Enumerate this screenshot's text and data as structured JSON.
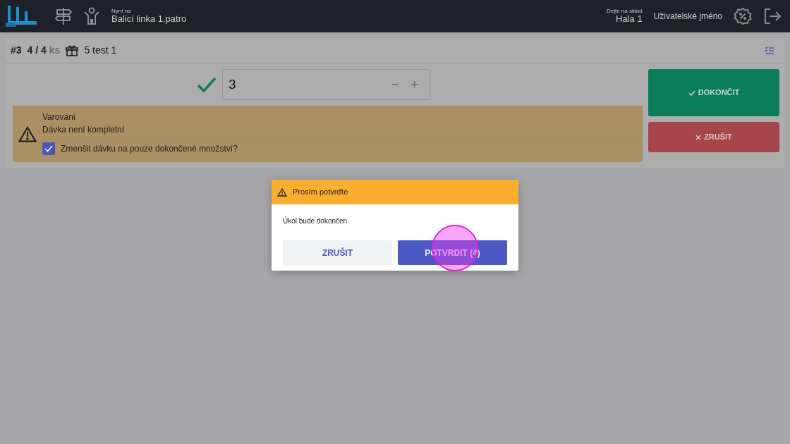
{
  "header": {
    "location_label": "Nyní na",
    "location": "Balicí linka 1.patro",
    "warehouse_label": "Dejte na sklad",
    "warehouse": "Hala 1",
    "username": "Uživatelské jméno"
  },
  "task": {
    "number": "#3",
    "quantity": "4 / 4",
    "unit": "ks",
    "product": "5 test 1"
  },
  "quantity_input": {
    "value": "3",
    "minus": "−",
    "plus": "+"
  },
  "alert": {
    "title": "Varování",
    "message": "Dávka není kompletní",
    "checkbox": {
      "label": "Zmenšit dávku na pouze dokončené množství?",
      "checked": true
    }
  },
  "actions": [
    {
      "label": "DOKONČIT",
      "kind": "finish"
    },
    {
      "label": "ZRUŠIT",
      "kind": "cancel"
    }
  ],
  "dialog": {
    "title": "Prosím potvrďte",
    "message": "Úkol bude dokončen",
    "buttons": [
      {
        "label": "ZRUŠIT",
        "kind": "secondary"
      },
      {
        "label": "POTVRDIT (4)",
        "kind": "primary"
      }
    ]
  }
}
